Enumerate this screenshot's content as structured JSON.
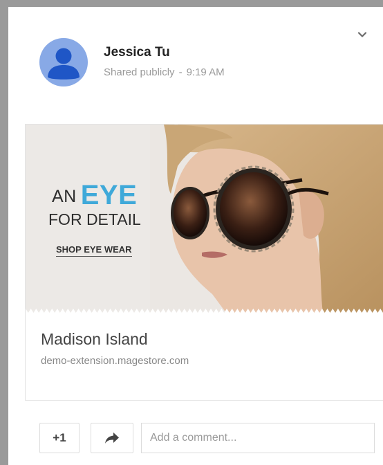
{
  "post": {
    "author": "Jessica Tu",
    "visibility": "Shared publicly",
    "separator": "-",
    "time": "9:19 AM"
  },
  "banner": {
    "line1_prefix": "AN",
    "line1_emphasis": "EYE",
    "line2": "FOR DETAIL",
    "cta": "SHOP EYE WEAR"
  },
  "link": {
    "title": "Madison Island",
    "domain": "demo-extension.magestore.com"
  },
  "actions": {
    "plus_one_label": "+1",
    "comment_placeholder": "Add a comment..."
  },
  "icons": {
    "collapse": "chevron-down-icon",
    "share": "share-arrow-icon",
    "avatar": "default-avatar-icon"
  },
  "colors": {
    "avatar_bg": "#88a9e6",
    "accent_eye": "#3fa9d9"
  }
}
